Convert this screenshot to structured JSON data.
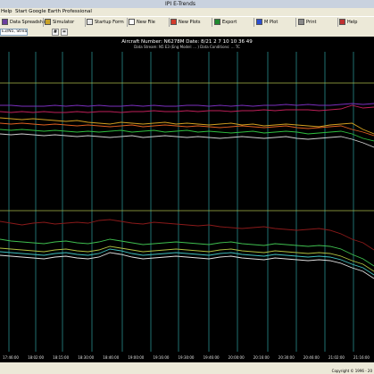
{
  "window": {
    "title": "IPI E-Trends"
  },
  "menu": {
    "items": [
      "Help",
      "Start Google Earth Professional"
    ]
  },
  "toolbar": {
    "items": [
      {
        "label": "Data Spreadsheet",
        "icon": "spreadsheet-icon",
        "color": "#6b3fa0"
      },
      {
        "label": "Simulator",
        "icon": "simulator-icon",
        "color": "#c9a227"
      },
      {
        "label": "Startup Form",
        "icon": "form-icon",
        "color": "#e8e8e8"
      },
      {
        "label": "New File",
        "icon": "new-file-icon",
        "color": "#ffffff"
      },
      {
        "label": "New Plots",
        "icon": "new-plots-icon",
        "color": "#d23b2b"
      },
      {
        "label": "Export",
        "icon": "export-icon",
        "color": "#1f8a2e"
      },
      {
        "label": "M Plot",
        "icon": "plot-icon",
        "color": "#2b4fd2"
      },
      {
        "label": "Print",
        "icon": "print-icon",
        "color": "#8a8a8a"
      },
      {
        "label": "Help",
        "icon": "help-icon",
        "color": "#c03030"
      }
    ]
  },
  "toolbar2": {
    "dropdown_value": "E3/N5, Stream 1",
    "buttons": [
      "#",
      "="
    ]
  },
  "chart_header": {
    "title": "Aircraft Number: N6278M Date: 8/21 2 7 10 10 36 49",
    "subtitle": "Data Stream: N5 E3 (Eng Model: ... ) Data Conditions: ... TC"
  },
  "status": {
    "copyright": "Copyright © 1996 - 20"
  },
  "chart_data": {
    "type": "line",
    "xlabels": [
      "17:46:00",
      "18:02:00",
      "18:15:00",
      "18:30:00",
      "18:46:00",
      "19:00:00",
      "19:16:00",
      "19:30:00",
      "19:46:00",
      "20:00:00",
      "20:16:00",
      "20:30:00",
      "20:46:00",
      "21:02:00",
      "21:16:00"
    ],
    "colors": {
      "grid_vertical": "#2a8c8c",
      "grid_horizontal": "#a8b84a",
      "background": "#000000"
    },
    "series": [
      {
        "color": "#7b2fbf",
        "group": "upper",
        "values": [
          118,
          118,
          119,
          119,
          119,
          118,
          119,
          118,
          119,
          118,
          119,
          119,
          118,
          119,
          118,
          119,
          119,
          118,
          118,
          119,
          118,
          119,
          118,
          119,
          118,
          118,
          117,
          118,
          117,
          118,
          118,
          117,
          116,
          117,
          116
        ]
      },
      {
        "color": "#c0205a",
        "group": "upper",
        "values": [
          125,
          126,
          125,
          126,
          125,
          126,
          126,
          125,
          126,
          125,
          125,
          126,
          125,
          125,
          124,
          125,
          125,
          124,
          125,
          124,
          124,
          125,
          124,
          124,
          123,
          124,
          123,
          123,
          123,
          124,
          123,
          122,
          118,
          121,
          120
        ]
      },
      {
        "color": "#d4a020",
        "group": "upper",
        "values": [
          132,
          133,
          134,
          133,
          134,
          135,
          136,
          135,
          137,
          138,
          139,
          137,
          138,
          139,
          138,
          137,
          139,
          138,
          139,
          140,
          139,
          138,
          140,
          139,
          141,
          140,
          139,
          140,
          141,
          142,
          140,
          139,
          138,
          145,
          150
        ]
      },
      {
        "color": "#e06020",
        "group": "upper",
        "values": [
          138,
          139,
          138,
          139,
          140,
          139,
          140,
          141,
          140,
          141,
          142,
          141,
          140,
          142,
          141,
          140,
          141,
          142,
          141,
          142,
          143,
          142,
          141,
          142,
          143,
          142,
          141,
          143,
          144,
          143,
          142,
          141,
          145,
          148,
          152
        ]
      },
      {
        "color": "#2fbf3f",
        "group": "upper",
        "values": [
          145,
          146,
          145,
          146,
          147,
          146,
          147,
          148,
          147,
          148,
          147,
          146,
          148,
          147,
          146,
          148,
          147,
          146,
          148,
          147,
          148,
          149,
          148,
          147,
          149,
          148,
          147,
          148,
          150,
          149,
          148,
          147,
          150,
          155,
          158
        ]
      },
      {
        "color": "#cfcfcf",
        "group": "upper",
        "values": [
          150,
          151,
          150,
          151,
          152,
          151,
          152,
          153,
          152,
          153,
          154,
          153,
          152,
          154,
          153,
          152,
          153,
          154,
          153,
          154,
          155,
          154,
          153,
          154,
          155,
          154,
          153,
          155,
          156,
          155,
          154,
          153,
          156,
          160,
          165
        ]
      },
      {
        "color": "#8b1a1a",
        "group": "lower",
        "values": [
          248,
          250,
          252,
          250,
          249,
          251,
          250,
          249,
          250,
          247,
          246,
          248,
          250,
          251,
          249,
          250,
          251,
          252,
          253,
          252,
          254,
          255,
          256,
          255,
          254,
          256,
          257,
          258,
          257,
          256,
          258,
          262,
          268,
          272,
          280
        ]
      },
      {
        "color": "#3fbf4f",
        "group": "lower",
        "values": [
          268,
          270,
          271,
          272,
          273,
          271,
          270,
          272,
          273,
          271,
          268,
          270,
          272,
          274,
          273,
          272,
          271,
          272,
          273,
          274,
          272,
          271,
          273,
          274,
          275,
          273,
          274,
          275,
          276,
          275,
          276,
          279,
          285,
          290,
          298
        ]
      },
      {
        "color": "#b0c040",
        "group": "lower",
        "values": [
          278,
          279,
          280,
          281,
          282,
          280,
          279,
          281,
          282,
          280,
          276,
          278,
          280,
          282,
          281,
          280,
          279,
          280,
          281,
          282,
          280,
          279,
          281,
          282,
          283,
          281,
          282,
          283,
          284,
          283,
          284,
          287,
          292,
          296,
          304
        ]
      },
      {
        "color": "#40c0c0",
        "group": "lower",
        "values": [
          282,
          283,
          284,
          285,
          286,
          284,
          283,
          285,
          286,
          284,
          279,
          281,
          284,
          286,
          285,
          284,
          283,
          284,
          285,
          286,
          284,
          283,
          285,
          286,
          287,
          285,
          286,
          287,
          288,
          287,
          288,
          291,
          296,
          300,
          308
        ]
      },
      {
        "color": "#e0e0e0",
        "group": "lower",
        "values": [
          286,
          287,
          288,
          289,
          290,
          288,
          287,
          289,
          290,
          288,
          283,
          285,
          288,
          290,
          289,
          288,
          287,
          288,
          289,
          290,
          288,
          287,
          289,
          290,
          291,
          289,
          290,
          291,
          292,
          291,
          292,
          295,
          300,
          304,
          312
        ]
      }
    ]
  }
}
